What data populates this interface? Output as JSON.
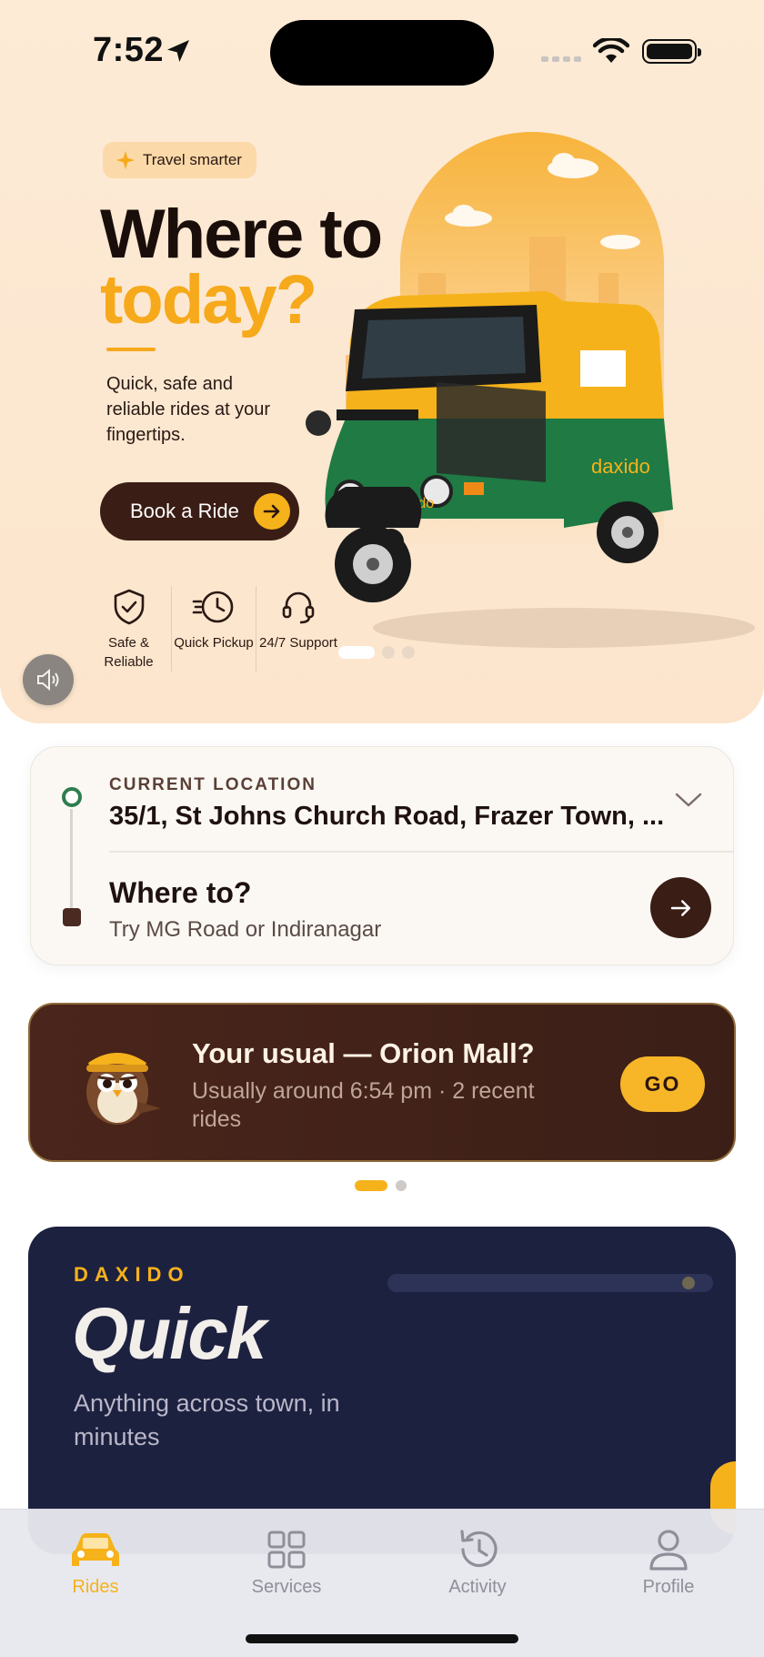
{
  "status_bar": {
    "time": "7:52"
  },
  "hero": {
    "tag": "Travel smarter",
    "headline_line1": "Where to",
    "headline_line2": "today?",
    "subtext": "Quick, safe and reliable rides at your fingertips.",
    "cta_label": "Book a Ride",
    "features": [
      {
        "icon": "shield-check-icon",
        "label": "Safe & Reliable"
      },
      {
        "icon": "fast-clock-icon",
        "label": "Quick Pickup"
      },
      {
        "icon": "headset-icon",
        "label": "24/7 Support"
      }
    ],
    "brand_on_vehicle": "daxido",
    "carousel": {
      "count": 3,
      "active_index": 0
    }
  },
  "location": {
    "current_label": "CURRENT LOCATION",
    "current_value": "35/1, St Johns Church Road, Frazer Town, ...",
    "destination_title": "Where to?",
    "destination_hint": "Try MG Road or Indiranagar"
  },
  "usual": {
    "title": "Your usual — Orion Mall?",
    "subtitle": "Usually around 6:54 pm · 2 recent rides",
    "go_label": "GO",
    "pager": {
      "count": 2,
      "active_index": 0
    }
  },
  "quick": {
    "brand": "DAXIDO",
    "title": "Quick",
    "subtitle": "Anything across town, in minutes"
  },
  "tabs": [
    {
      "label": "Rides",
      "icon": "car-icon",
      "active": true
    },
    {
      "label": "Services",
      "icon": "grid-icon",
      "active": false
    },
    {
      "label": "Activity",
      "icon": "history-icon",
      "active": false
    },
    {
      "label": "Profile",
      "icon": "person-icon",
      "active": false
    }
  ],
  "colors": {
    "accent": "#f6b21b",
    "brown": "#3a1d14",
    "green": "#2e7d4f",
    "navy": "#1d2140",
    "hero_bg": "#fdebd6"
  }
}
